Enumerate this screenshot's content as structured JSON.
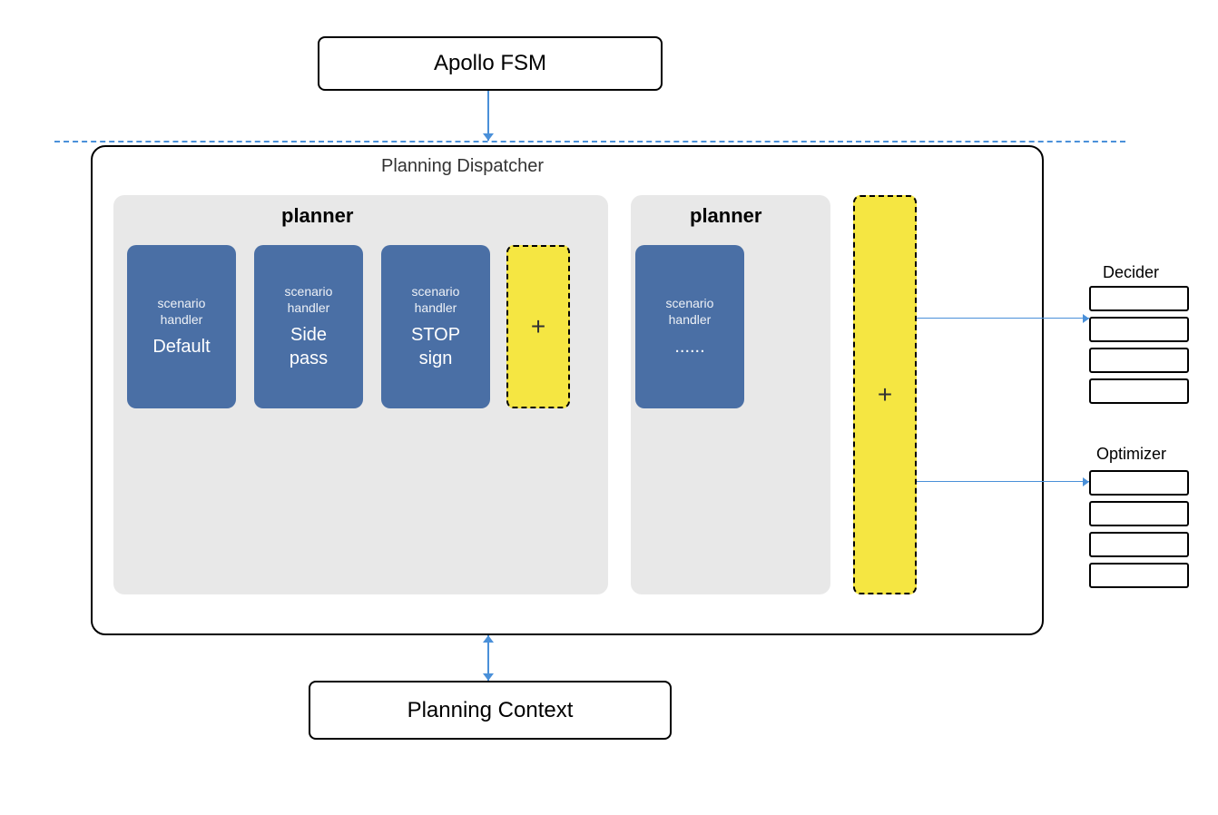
{
  "apollo_fsm": {
    "label": "Apollo FSM"
  },
  "planning_dispatcher": {
    "label": "Planning Dispatcher"
  },
  "planner_left": {
    "label": "planner"
  },
  "planner_right": {
    "label": "planner"
  },
  "scenario_handlers": [
    {
      "id": "default",
      "top_label": "scenario\nhandler",
      "main_label": "Default"
    },
    {
      "id": "sidepass",
      "top_label": "scenario\nhandler",
      "main_label": "Side\npass"
    },
    {
      "id": "stop",
      "top_label": "scenario\nhandler",
      "main_label": "STOP\nsign"
    },
    {
      "id": "dots",
      "top_label": "scenario\nhandler",
      "main_label": "......"
    }
  ],
  "add_plus": "+",
  "planning_context": {
    "label": "Planning Context"
  },
  "decider": {
    "label": "Decider",
    "stack_count": 4
  },
  "optimizer": {
    "label": "Optimizer",
    "stack_count": 4
  }
}
